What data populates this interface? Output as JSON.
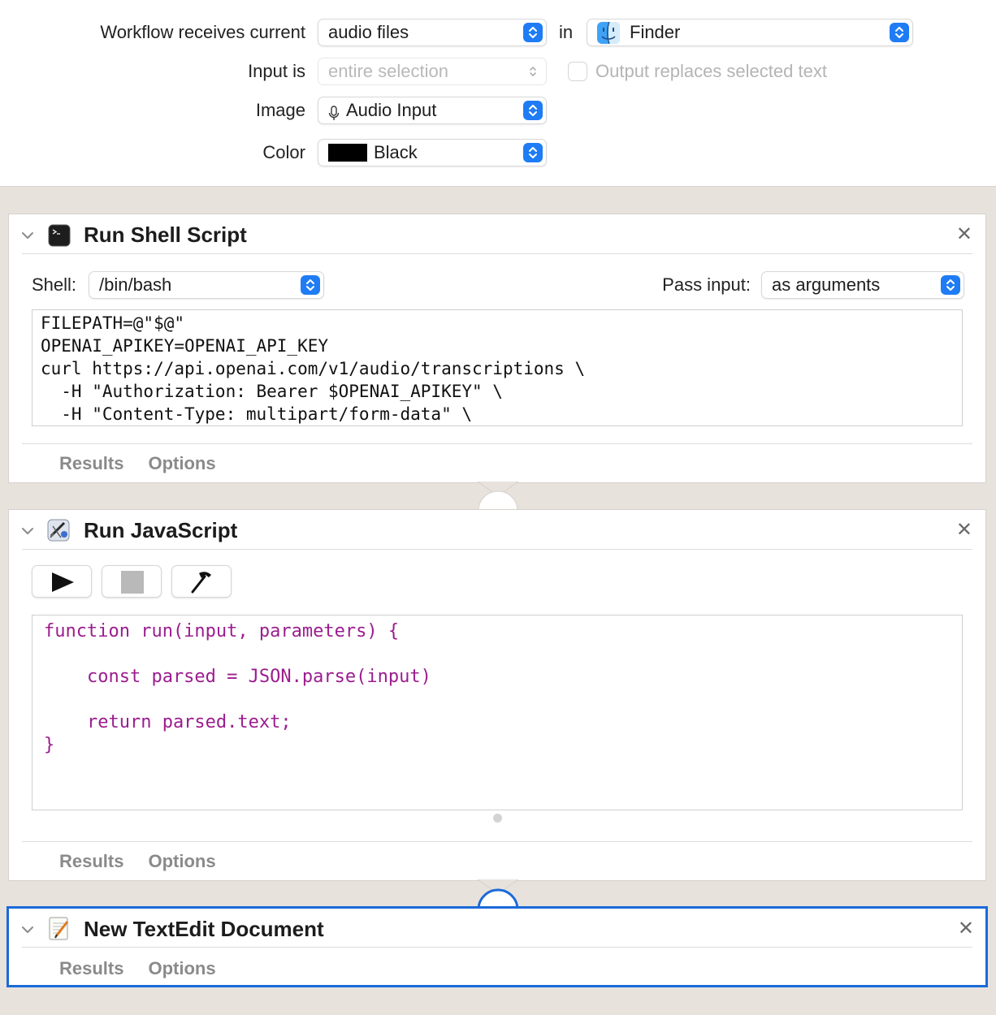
{
  "header": {
    "receives_label": "Workflow receives current",
    "receives_value": "audio files",
    "in_label": "in",
    "app_value": "Finder",
    "input_is_label": "Input is",
    "input_is_value": "entire selection",
    "output_replaces_label": "Output replaces selected text",
    "output_replaces_checked": false,
    "image_label": "Image",
    "image_value": "Audio Input",
    "image_icon": "microphone-icon",
    "color_label": "Color",
    "color_value": "Black",
    "color_swatch": "#000000"
  },
  "actions": [
    {
      "title": "Run Shell Script",
      "icon": "terminal-icon",
      "shell_label": "Shell:",
      "shell_value": "/bin/bash",
      "pass_input_label": "Pass input:",
      "pass_input_value": "as arguments",
      "code": "FILEPATH=@\"$@\"\nOPENAI_APIKEY=OPENAI_API_KEY\ncurl https://api.openai.com/v1/audio/transcriptions \\\n  -H \"Authorization: Bearer $OPENAI_APIKEY\" \\\n  -H \"Content-Type: multipart/form-data\" \\",
      "tabs": [
        "Results",
        "Options"
      ]
    },
    {
      "title": "Run JavaScript",
      "icon": "script-editor-icon",
      "toolbar": [
        "run-icon",
        "stop-icon",
        "compile-icon"
      ],
      "code": "function run(input, parameters) {\n\n    const parsed = JSON.parse(input)\n\n    return parsed.text;\n}",
      "tabs": [
        "Results",
        "Options"
      ]
    },
    {
      "title": "New TextEdit Document",
      "icon": "textedit-icon",
      "tabs": [
        "Results",
        "Options"
      ],
      "selected": true
    }
  ],
  "colors": {
    "accent": "#1f7cf5",
    "selection_border": "#1a6ad8",
    "code_keyword": "#9b1d8f",
    "canvas_bg": "#e8e2dd"
  }
}
